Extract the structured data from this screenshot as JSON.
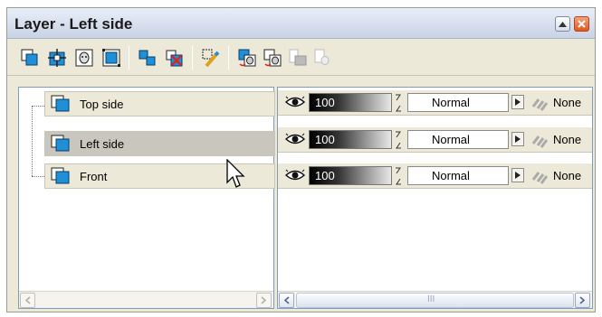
{
  "window": {
    "title": "Layer - Left side",
    "minimize_icon": "triangle-up-icon",
    "close_icon": "close-x-icon"
  },
  "toolbar": {
    "group1": [
      "new-layer-icon",
      "new-adjustment-layer-icon",
      "new-mask-layer-icon",
      "new-vector-layer-icon"
    ],
    "group2": [
      "duplicate-layer-icon",
      "delete-layer-icon"
    ],
    "group3": [
      "edit-selection-icon"
    ],
    "group4": [
      "mask-from-image-icon",
      "mask-invert-icon",
      "mask-disabled-icon",
      "mask-delete-disabled-icon"
    ]
  },
  "layers": [
    {
      "name": "Top side",
      "selected": false
    },
    {
      "name": "Left side",
      "selected": true
    },
    {
      "name": "Front",
      "selected": false
    }
  ],
  "properties": [
    {
      "visibility_icon": "eye-icon",
      "opacity": "100",
      "blend_mode": "Normal",
      "link": "None"
    },
    {
      "visibility_icon": "eye-icon",
      "opacity": "100",
      "blend_mode": "Normal",
      "link": "None"
    },
    {
      "visibility_icon": "eye-icon",
      "opacity": "100",
      "blend_mode": "Normal",
      "link": "None"
    }
  ],
  "right_scrollbar": {
    "thumb_grip": "III"
  },
  "colors": {
    "accent_blue": "#1f8fd8",
    "panel_bg": "#ece9d8",
    "close_orange": "#e0571f"
  }
}
